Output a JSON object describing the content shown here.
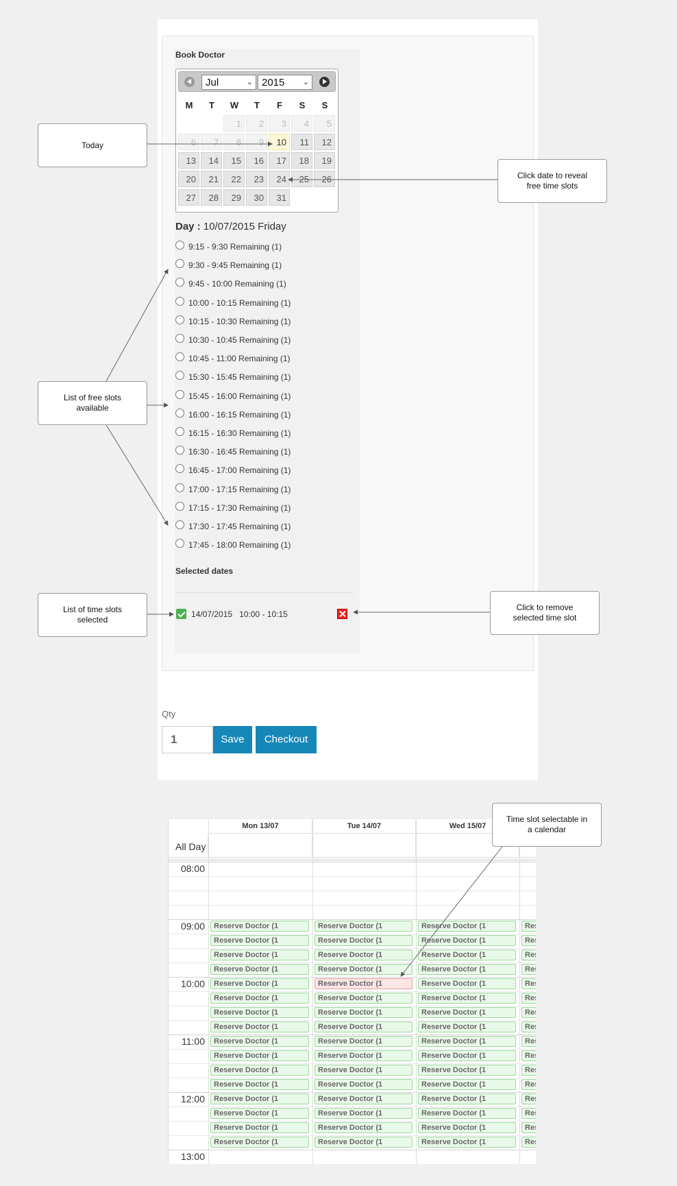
{
  "form": {
    "title": "Book Doctor",
    "calendar": {
      "month": "Jul",
      "year": "2015",
      "weekdays": [
        "M",
        "T",
        "W",
        "T",
        "F",
        "S",
        "S"
      ],
      "days": [
        {
          "d": "1",
          "state": "past"
        },
        {
          "d": "2",
          "state": "past"
        },
        {
          "d": "3",
          "state": "past"
        },
        {
          "d": "4",
          "state": "past"
        },
        {
          "d": "5",
          "state": "past"
        },
        {
          "d": "6",
          "state": "past"
        },
        {
          "d": "7",
          "state": "past"
        },
        {
          "d": "8",
          "state": "past"
        },
        {
          "d": "9",
          "state": "past"
        },
        {
          "d": "10",
          "state": "today"
        },
        {
          "d": "11",
          "state": "avail"
        },
        {
          "d": "12",
          "state": "avail"
        },
        {
          "d": "13",
          "state": "avail"
        },
        {
          "d": "14",
          "state": "avail"
        },
        {
          "d": "15",
          "state": "avail"
        },
        {
          "d": "16",
          "state": "avail"
        },
        {
          "d": "17",
          "state": "avail"
        },
        {
          "d": "18",
          "state": "avail"
        },
        {
          "d": "19",
          "state": "avail"
        },
        {
          "d": "20",
          "state": "avail"
        },
        {
          "d": "21",
          "state": "avail"
        },
        {
          "d": "22",
          "state": "avail"
        },
        {
          "d": "23",
          "state": "avail"
        },
        {
          "d": "24",
          "state": "avail"
        },
        {
          "d": "25",
          "state": "avail"
        },
        {
          "d": "26",
          "state": "avail"
        },
        {
          "d": "27",
          "state": "avail"
        },
        {
          "d": "28",
          "state": "avail"
        },
        {
          "d": "29",
          "state": "avail"
        },
        {
          "d": "30",
          "state": "avail"
        },
        {
          "d": "31",
          "state": "avail"
        }
      ]
    },
    "day_label": "Day :",
    "day_value": "10/07/2015 Friday",
    "slots": [
      "9:15 - 9:30 Remaining (1)",
      "9:30 - 9:45 Remaining (1)",
      "9:45 - 10:00 Remaining (1)",
      "10:00 - 10:15 Remaining (1)",
      "10:15 - 10:30 Remaining (1)",
      "10:30 - 10:45 Remaining (1)",
      "10:45 - 11:00 Remaining (1)",
      "15:30 - 15:45 Remaining (1)",
      "15:45 - 16:00 Remaining (1)",
      "16:00 - 16:15 Remaining (1)",
      "16:15 - 16:30 Remaining (1)",
      "16:30 - 16:45 Remaining (1)",
      "16:45 - 17:00 Remaining (1)",
      "17:00 - 17:15 Remaining (1)",
      "17:15 - 17:30 Remaining (1)",
      "17:30 - 17:45 Remaining (1)",
      "17:45 - 18:00 Remaining (1)"
    ],
    "selected_title": "Selected dates",
    "selected_items": [
      {
        "date": "14/07/2015",
        "time": "10:00 - 10:15"
      }
    ],
    "qty_label": "Qty",
    "qty_value": "1",
    "save_label": "Save",
    "checkout_label": "Checkout"
  },
  "callouts": {
    "today": "Today",
    "click_date": "Click date to reveal free time slots",
    "free_slots": "List of free slots available",
    "slots_selected": "List of time slots selected",
    "remove": "Click to remove selected time slot",
    "calendar": "Time slot selectable in a calendar"
  },
  "week_calendar": {
    "columns": [
      "Mon 13/07",
      "Tue 14/07",
      "Wed 15/07",
      ""
    ],
    "all_day_label": "All Day",
    "hours": [
      "08:00",
      "09:00",
      "10:00",
      "11:00",
      "12:00",
      "13:00"
    ],
    "event_label": "Reserve Doctor (1",
    "selected": {
      "column": 1,
      "slot_index": 4
    }
  },
  "colors": {
    "button": "#1687b9",
    "event_bg": "#e9f9e9",
    "event_selected_bg": "#fde6e6",
    "today_bg": "#fcf6d7",
    "check": "#4caf50",
    "remove": "#e22222"
  }
}
